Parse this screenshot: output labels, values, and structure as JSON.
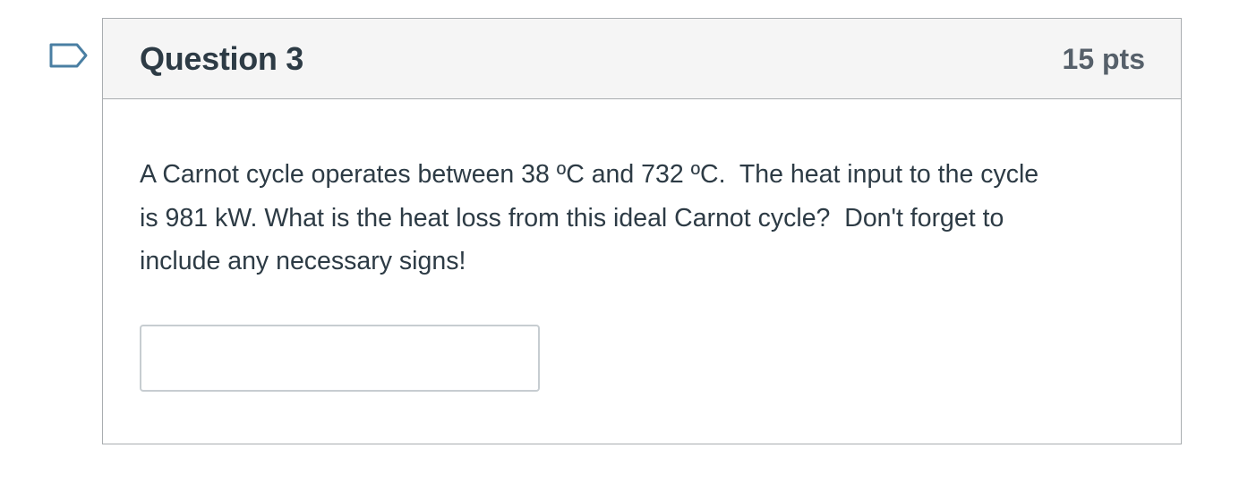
{
  "question": {
    "title": "Question 3",
    "points": "15 pts",
    "text_lines": [
      "A Carnot cycle operates between 38 ºC and 732 ºC.  The heat input to the cycle",
      "is 981 kW. What is the heat loss from this ideal Carnot cycle?  Don't forget to",
      "include any necessary signs!"
    ],
    "answer": {
      "value": "",
      "placeholder": ""
    }
  },
  "flag": {
    "icon": "flag-question-icon",
    "color": "#4a7fa3"
  },
  "colors": {
    "border": "#a9adb0",
    "header_bg": "#f5f5f5",
    "text": "#2d3b45",
    "points_text": "#56606a"
  }
}
